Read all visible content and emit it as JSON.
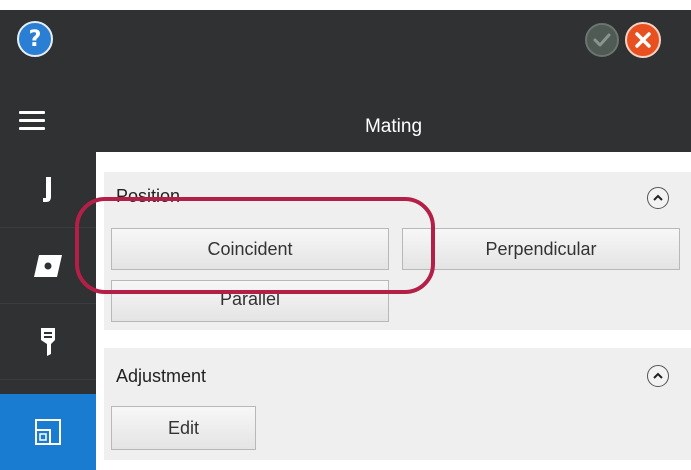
{
  "header": {
    "title": "Mating",
    "help_glyph": "?"
  },
  "icons": {
    "help": "help-icon",
    "confirm": "checkmark-icon",
    "cancel": "close-icon",
    "menu": "hamburger-menu-icon",
    "rail": [
      "fixture-icon",
      "part-icon",
      "tool-icon",
      "mating-icon"
    ]
  },
  "position_section": {
    "title": "Position",
    "buttons": [
      "Coincident",
      "Perpendicular",
      "Parallel"
    ]
  },
  "adjustment_section": {
    "title": "Adjustment",
    "edit_label": "Edit"
  },
  "colors": {
    "dark_bg": "#2f3133",
    "active_rail": "#1a7cd0",
    "cancel": "#e8511f",
    "highlight": "#b41f48"
  }
}
